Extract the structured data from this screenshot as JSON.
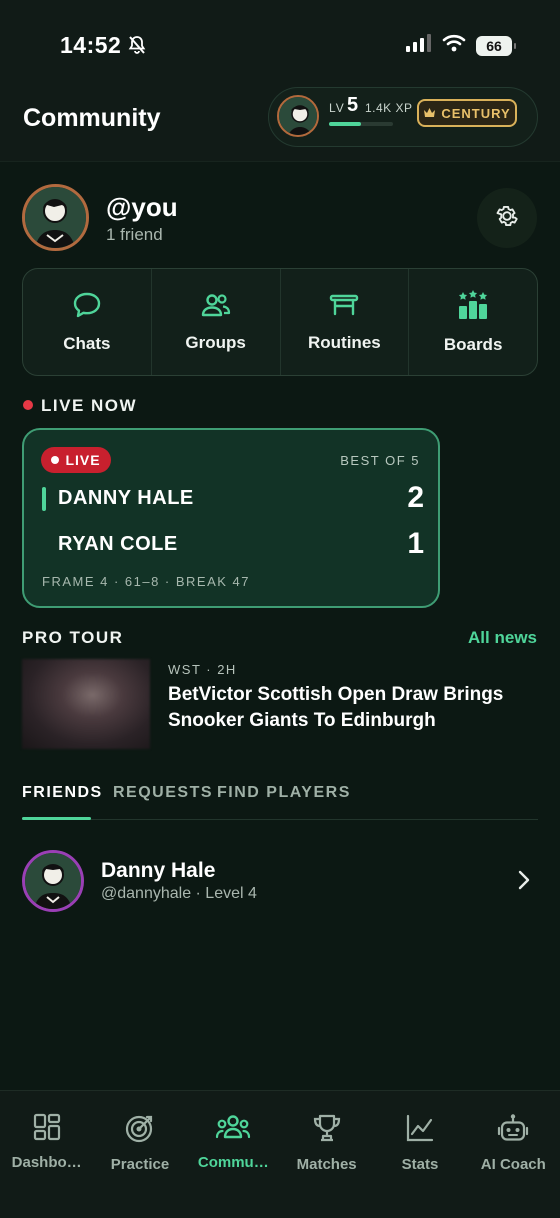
{
  "status_bar": {
    "time": "14:52",
    "battery": "66"
  },
  "header": {
    "title": "Community",
    "xp": {
      "lv_prefix": "LV",
      "level": "5",
      "xp_text": "1.4K XP",
      "progress": 0.5,
      "badge": "CENTURY"
    }
  },
  "profile": {
    "handle": "@you",
    "friends": "1 friend"
  },
  "quick_actions": [
    {
      "label": "Chats",
      "icon": "chat-bubble-icon"
    },
    {
      "label": "Groups",
      "icon": "groups-icon"
    },
    {
      "label": "Routines",
      "icon": "table-icon"
    },
    {
      "label": "Boards",
      "icon": "leaderboard-icon"
    }
  ],
  "live_now": {
    "heading": "LIVE NOW",
    "badge": "LIVE",
    "best_of": "BEST OF 5",
    "players": [
      {
        "name": "DANNY HALE",
        "score": "2"
      },
      {
        "name": "RYAN COLE",
        "score": "1"
      }
    ],
    "frame_info": "FRAME 4 · 61–8 · BREAK 47"
  },
  "pro_tour": {
    "heading": "PRO TOUR",
    "all_news": "All news",
    "article": {
      "meta": "WST · 2H",
      "title": "BetVictor Scottish Open Draw Brings Snooker Giants To Edinburgh"
    }
  },
  "tabs": [
    "FRIENDS",
    "REQUESTS",
    "FIND PLAYERS"
  ],
  "friends": [
    {
      "name": "Danny Hale",
      "sub": "@dannyhale · Level 4"
    }
  ],
  "bottom_nav": [
    {
      "label": "Dashbo…",
      "icon": "dashboard-icon"
    },
    {
      "label": "Practice",
      "icon": "target-icon"
    },
    {
      "label": "Commu…",
      "icon": "community-icon",
      "active": true
    },
    {
      "label": "Matches",
      "icon": "trophy-icon"
    },
    {
      "label": "Stats",
      "icon": "stats-chart-icon"
    },
    {
      "label": "AI Coach",
      "icon": "robot-icon"
    }
  ],
  "colors": {
    "accent": "#4fd59a",
    "live_red": "#c8202e",
    "gold": "#e8c06a",
    "background": "#0c1813"
  }
}
